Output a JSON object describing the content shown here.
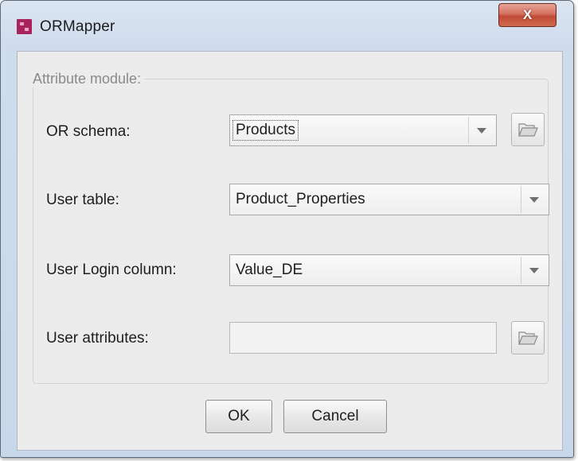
{
  "window": {
    "title": "ORMapper",
    "close_label": "X"
  },
  "group": {
    "legend": "Attribute module:"
  },
  "fields": {
    "or_schema": {
      "label": "OR schema:",
      "value": "Products"
    },
    "user_table": {
      "label": "User table:",
      "value": "Product_Properties"
    },
    "user_login_column": {
      "label": "User Login column:",
      "value": "Value_DE"
    },
    "user_attributes": {
      "label": "User attributes:",
      "value": ""
    }
  },
  "buttons": {
    "ok": "OK",
    "cancel": "Cancel"
  },
  "icons": {
    "app": "ormapper-app-icon",
    "browse": "folder-open-icon",
    "dropdown": "chevron-down-icon",
    "close": "close-icon"
  },
  "colors": {
    "app_icon": "#a8235e",
    "close_button": "#c24b35",
    "dialog_background": "#ececec"
  }
}
